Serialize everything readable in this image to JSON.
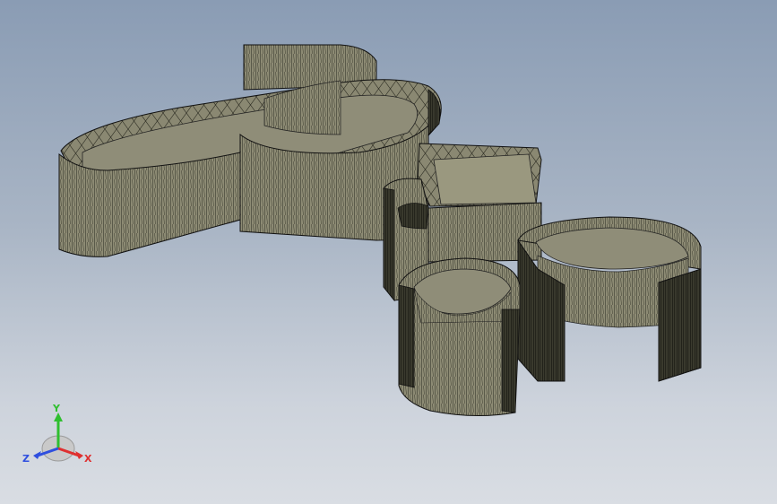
{
  "viewport": {
    "model_color": "#8a8872",
    "edge_color": "#1c1c16",
    "background_top": "#8a9cb4",
    "background_bottom": "#d9dde3"
  },
  "triad": {
    "y_label": "Y",
    "z_label": "Z",
    "x_label": "X",
    "y_color": "#2fbf2f",
    "z_color": "#2f4fdf",
    "x_color": "#df2f2f"
  }
}
